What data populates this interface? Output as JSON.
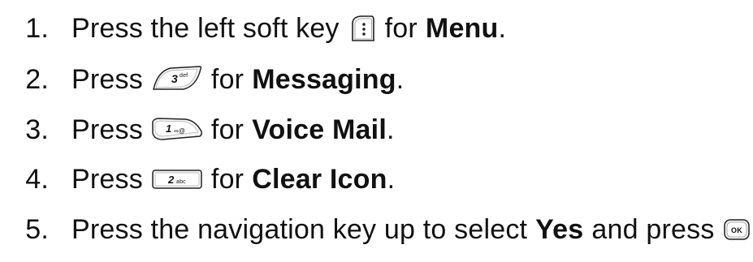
{
  "steps": [
    {
      "number": "1.",
      "before": "Press the left soft key",
      "key_icon": "left-soft-key-menu-icon",
      "key_label": "",
      "mid": "for",
      "bold": "Menu",
      "after": "."
    },
    {
      "number": "2.",
      "before": "Press",
      "key_icon": "key-3-def-icon",
      "key_label": "3",
      "key_sub": "def",
      "mid": "for",
      "bold": "Messaging",
      "after": "."
    },
    {
      "number": "3.",
      "before": "Press",
      "key_icon": "key-1-voicemail-icon",
      "key_label": "1",
      "key_sub": "∞@",
      "mid": "for",
      "bold": "Voice Mail",
      "after": "."
    },
    {
      "number": "4.",
      "before": "Press",
      "key_icon": "key-2-abc-icon",
      "key_label": "2",
      "key_sub": "abc",
      "mid": "for",
      "bold": "Clear Icon",
      "after": "."
    },
    {
      "number": "5.",
      "before": "Press the navigation key up to select",
      "bold": "Yes",
      "mid": "and press",
      "key_icon": "ok-key-icon",
      "key_label": "OK",
      "after": "."
    }
  ]
}
